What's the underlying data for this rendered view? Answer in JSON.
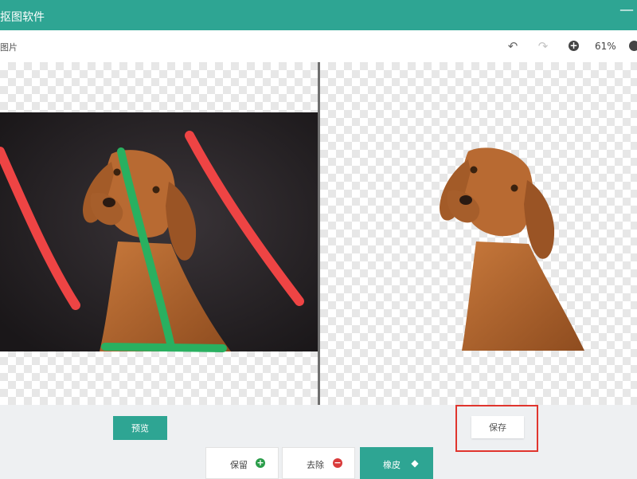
{
  "window": {
    "title": "抠图软件",
    "minimize_glyph": "—"
  },
  "toolbar": {
    "breadcrumb": "图片",
    "undo_icon": "undo-icon",
    "redo_icon": "redo-icon",
    "zoom_in_icon": "zoom-in-icon",
    "zoom_level": "61%",
    "zoom_out_icon": "zoom-out-icon"
  },
  "canvas": {
    "left_pane": "original photo with keep/remove strokes",
    "right_pane": "cutout result on transparent background",
    "stroke_colors": {
      "keep": "#29b060",
      "remove": "#ee4444"
    }
  },
  "bottom": {
    "preview_label": "预览",
    "save_label": "保存",
    "actions": [
      {
        "label": "保留",
        "icon": "plus-circle-icon",
        "color": "#2a9d4a"
      },
      {
        "label": "去除",
        "icon": "minus-circle-icon",
        "color": "#d93b3b"
      },
      {
        "label": "橡皮",
        "icon": "eraser-icon",
        "color": "#2ea593"
      }
    ]
  },
  "colors": {
    "accent": "#2ea593",
    "highlight": "#e0352e"
  }
}
